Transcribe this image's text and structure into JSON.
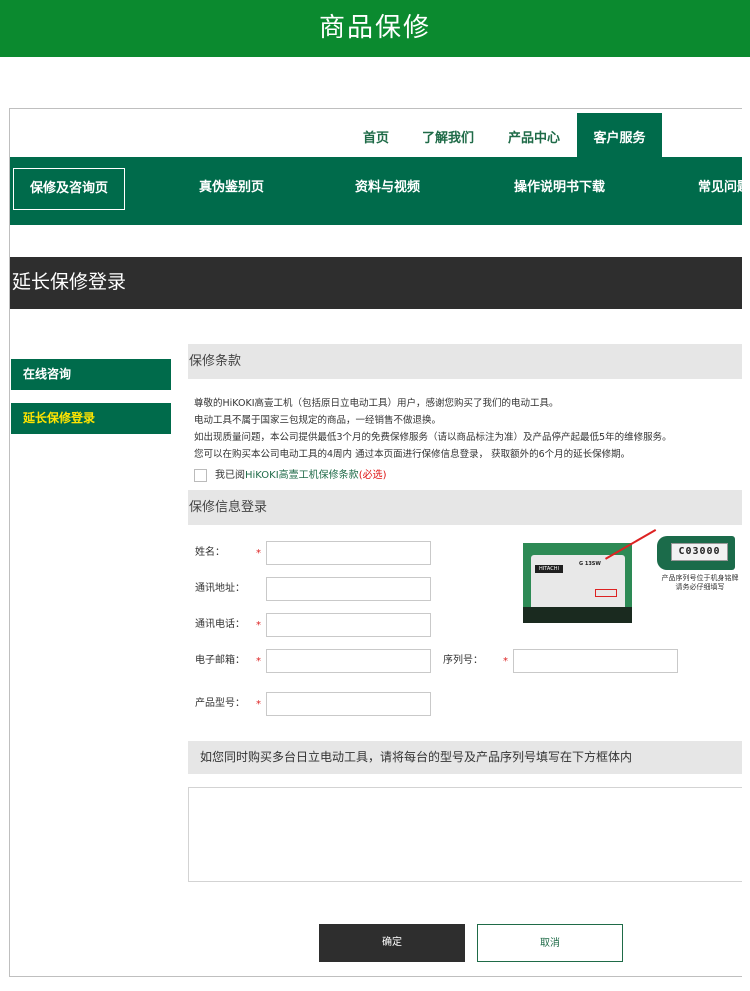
{
  "banner": {
    "title": "商品保修"
  },
  "top_nav": [
    {
      "label": "首页"
    },
    {
      "label": "了解我们"
    },
    {
      "label": "产品中心"
    },
    {
      "label": "客户服务",
      "active": true
    }
  ],
  "sub_nav": [
    {
      "label": "保修及咨询页",
      "active": true
    },
    {
      "label": "真伪鉴别页"
    },
    {
      "label": "资料与视频"
    },
    {
      "label": "操作说明书下载"
    },
    {
      "label": "常见问题"
    }
  ],
  "page_title": "延长保修登录",
  "sidebar": [
    {
      "label": "在线咨询"
    },
    {
      "label": "延长保修登录",
      "active": true
    }
  ],
  "terms": {
    "heading": "保修条款",
    "lines": [
      "尊敬的HiKOKI高壹工机（包括原日立电动工具）用户，感谢您购买了我们的电动工具。",
      "电动工具不属于国家三包规定的商品，一经销售不做退换。",
      "如出现质量问题，本公司提供最低3个月的免费保修服务（请以商品标注为准）及产品停产起最低5年的维修服务。",
      "您可以在购买本公司电动工具的4周内 通过本页面进行保修信息登录， 获取额外的6个月的延长保修期。"
    ],
    "agree_prefix": "我已阅",
    "agree_link": "HiKOKI高壹工机保修条款",
    "agree_required": "(必选)"
  },
  "form": {
    "heading": "保修信息登录",
    "name_label": "姓名：",
    "address_label": "通讯地址：",
    "phone_label": "通讯电话：",
    "email_label": "电子邮箱：",
    "serial_label": "序列号：",
    "model_label": "产品型号：",
    "required_mark": "*"
  },
  "product_image": {
    "brand": "HITACHI",
    "model": "G 13SW",
    "serial_sample": "C03000",
    "caption_line1": "产品序列号位于机身铭牌",
    "caption_line2": "请务必仔细填写"
  },
  "multi_note": "如您同时购买多台日立电动工具，请将每台的型号及产品序列号填写在下方框体内",
  "buttons": {
    "ok": "确定",
    "cancel": "取消"
  },
  "colors": {
    "banner_green": "#0b8a2f",
    "nav_green": "#006b4b",
    "title_dark": "#2e2e2e",
    "required_red": "#dd2222"
  }
}
